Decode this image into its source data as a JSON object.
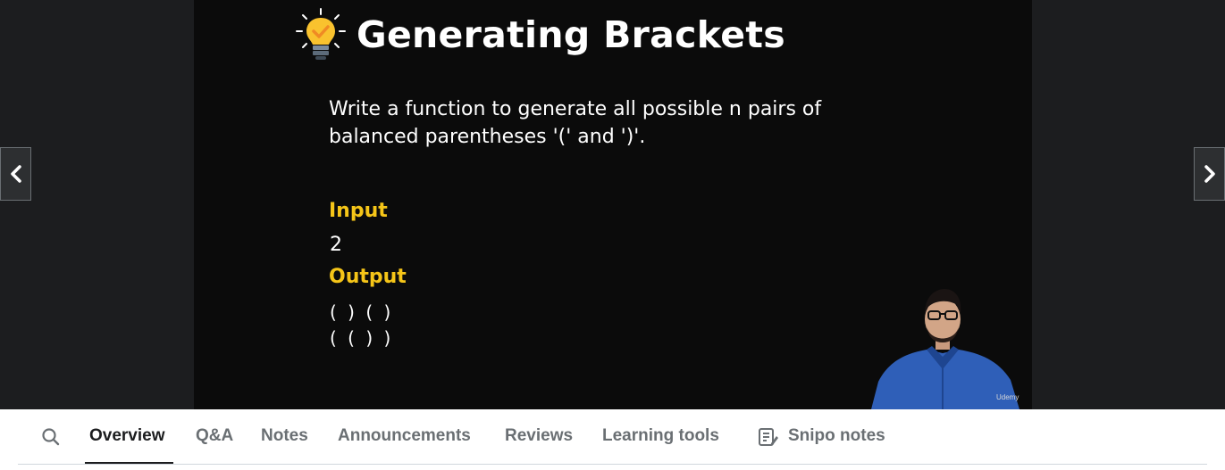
{
  "slide": {
    "title": "Generating Brackets",
    "description_line1": "Write a function to generate all possible n pairs of",
    "description_line2": "balanced parentheses '(' and ')'.",
    "input_label": "Input",
    "input_value": "2",
    "output_label": "Output",
    "output_lines": [
      "( ) ( )",
      "( ( ) )"
    ],
    "watermark": "Udemy",
    "colors": {
      "heading": "#ffffff",
      "label": "#f5c518",
      "background": "#0b0b0b"
    }
  },
  "icons": {
    "prev": "chevron-left-icon",
    "next": "chevron-right-icon",
    "search": "search-icon",
    "title_bulb": "lightbulb-icon",
    "snipo": "notes-icon"
  },
  "tabs": [
    {
      "label": "Overview",
      "active": true
    },
    {
      "label": "Q&A",
      "active": false
    },
    {
      "label": "Notes",
      "active": false
    },
    {
      "label": "Announcements",
      "active": false
    },
    {
      "label": "Reviews",
      "active": false
    },
    {
      "label": "Learning tools",
      "active": false
    },
    {
      "label": "Snipo notes",
      "active": false
    }
  ]
}
